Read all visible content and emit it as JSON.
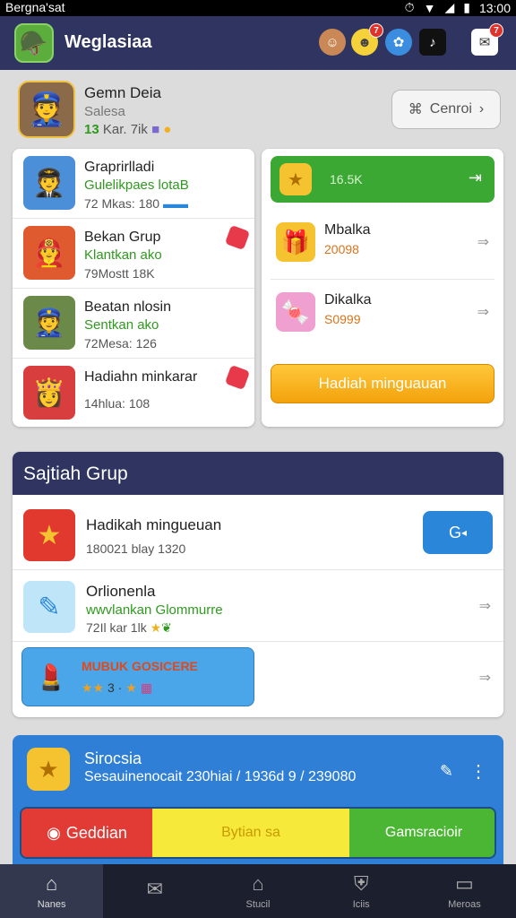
{
  "status_bar": {
    "left_text": "Bergna'sat",
    "time": "13:00"
  },
  "app_bar": {
    "title": "Weglasiaa",
    "notif_badge": "7",
    "msg_badge": "7"
  },
  "profile": {
    "name": "Gemn Deia",
    "subtitle": "Salesa",
    "stat_green": "13",
    "stat_text": "Kar. 7ik",
    "cancel_label": "Cenroi"
  },
  "groups_left": [
    {
      "title": "Graprirlladi",
      "subtitle": "Gulelikpaes lotaB",
      "meta": "72 Mkas: 180"
    },
    {
      "title": "Bekan Grup",
      "subtitle": "Klantkan ako",
      "meta": "79Mostt 18K"
    },
    {
      "title": "Beatan nlosin",
      "subtitle": "Sentkan ako",
      "meta": "72Mesa: 126"
    },
    {
      "title": "Hadiahn minkarar",
      "subtitle": "",
      "meta": "14hlua: 108"
    }
  ],
  "rewards": {
    "top_value": "16.5K",
    "items": [
      {
        "title": "Mbalka",
        "value": "20098"
      },
      {
        "title": "Dikalka",
        "value": "S0999"
      }
    ],
    "button_label": "Hadiah minguauan"
  },
  "group_section": {
    "header": "Sajtiah Grup",
    "rows": [
      {
        "title": "Hadikah mingueuan",
        "meta": "180021 blay 1320",
        "action_label": "G"
      },
      {
        "title": "Orlionenla",
        "subtitle": "wwvlankan Glommurre",
        "meta": "72Il kar 1lk"
      }
    ],
    "tile": {
      "title": "MUBUK GOSICERE",
      "rating": "3 ·"
    }
  },
  "sirocia": {
    "title": "Sirocsia",
    "subtitle": "Sesauinenocait 230hiai / 1936d 9 / 239080",
    "buttons": [
      "Geddian",
      "Bytian sa",
      "Gamsracioir"
    ]
  },
  "nav": [
    {
      "label": "Nanes",
      "icon": "home-icon"
    },
    {
      "label": "",
      "icon": "mail-icon"
    },
    {
      "label": "Stucil",
      "icon": "store-icon"
    },
    {
      "label": "Iciis",
      "icon": "shield-icon"
    },
    {
      "label": "Meroas",
      "icon": "briefcase-icon"
    }
  ]
}
